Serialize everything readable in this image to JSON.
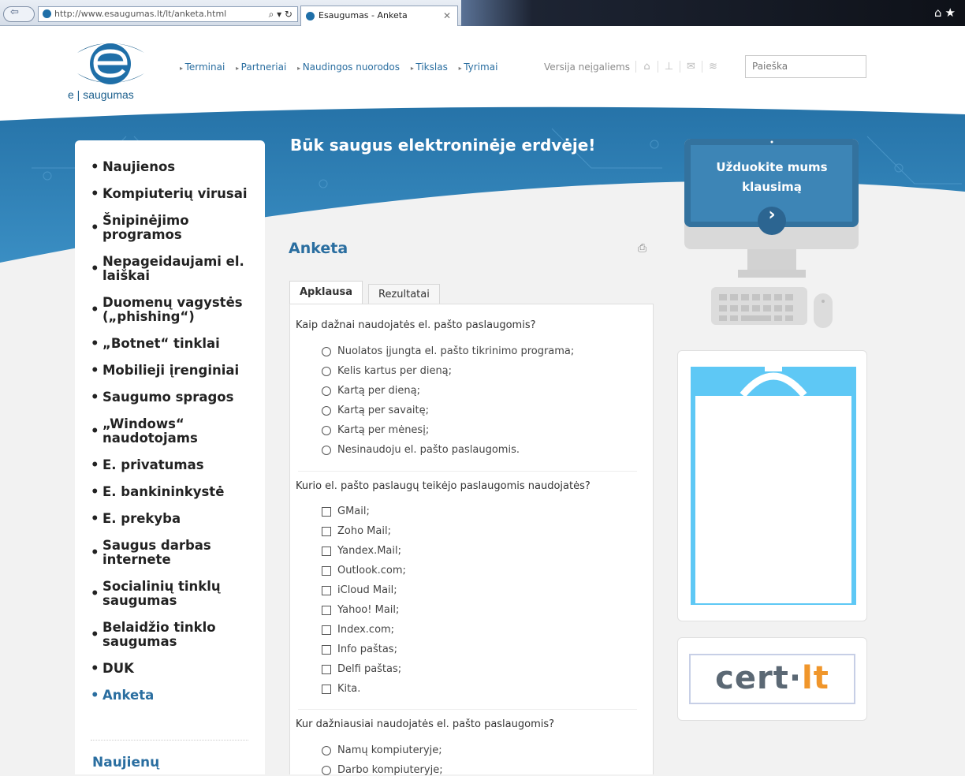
{
  "browser": {
    "url": "http://www.esaugumas.lt/lt/anketa.html",
    "tab_title": "Esaugumas - Anketa"
  },
  "header": {
    "logo_text": "e | saugumas",
    "nav": [
      "Terminai",
      "Partneriai",
      "Naudingos nuorodos",
      "Tikslas",
      "Tyrimai"
    ],
    "accessible_version": "Versija neįgaliems",
    "icons": [
      "home-icon",
      "sitemap-icon",
      "mail-icon",
      "rss-icon"
    ],
    "search_placeholder": "Paieška"
  },
  "banner": {
    "slogan": "Būk saugus elektroninėje erdvėje!",
    "ask_line1": "Užduokite mums",
    "ask_line2": "klausimą",
    "ask_arrow": "›"
  },
  "sidebar": {
    "items": [
      "Naujienos",
      "Kompiuterių virusai",
      "Šnipinėjimo programos",
      "Nepageidaujami el. laiškai",
      "Duomenų vagystės („phishing“)",
      "„Botnet“ tinklai",
      "Mobilieji įrenginiai",
      "Saugumo spragos",
      "„Windows“ naudotojams",
      "E. privatumas",
      "E. bankininkystė",
      "E. prekyba",
      "Saugus darbas internete",
      "Socialinių tinklų saugumas",
      "Belaidžio tinklo saugumas",
      "DUK",
      "Anketa"
    ],
    "active_item": "Anketa",
    "news_heading": "Naujienų"
  },
  "main": {
    "title": "Anketa",
    "tabs": [
      "Apklausa",
      "Rezultatai"
    ],
    "questions": [
      {
        "text": "Kaip dažnai naudojatės el. pašto paslaugomis?",
        "type": "radio",
        "options": [
          "Nuolatos įjungta el. pašto tikrinimo programa;",
          "Kelis kartus per dieną;",
          "Kartą per dieną;",
          "Kartą per savaitę;",
          "Kartą per mėnesį;",
          "Nesinaudoju el. pašto paslaugomis."
        ]
      },
      {
        "text": "Kurio el. pašto paslaugų teikėjo paslaugomis naudojatės?",
        "type": "checkbox",
        "options": [
          "GMail;",
          "Zoho Mail;",
          "Yandex.Mail;",
          "Outlook.com;",
          "iCloud Mail;",
          "Yahoo! Mail;",
          "Index.com;",
          "Info paštas;",
          "Delfi paštas;",
          "Kita."
        ]
      },
      {
        "text": "Kur dažniausiai naudojatės el. pašto paslaugomis?",
        "type": "radio",
        "options": [
          "Namų kompiuteryje;",
          "Darbo kompiuteryje;"
        ]
      }
    ]
  },
  "right": {
    "cert_part1": "cert·",
    "cert_part2": "lt"
  },
  "colors": {
    "brand_blue": "#2a6ea0",
    "banner_blue": "#2f7fb0",
    "monitor_screen": "#33729e",
    "widget_blue": "#5ec8f5",
    "cert_orange": "#f0962b"
  }
}
